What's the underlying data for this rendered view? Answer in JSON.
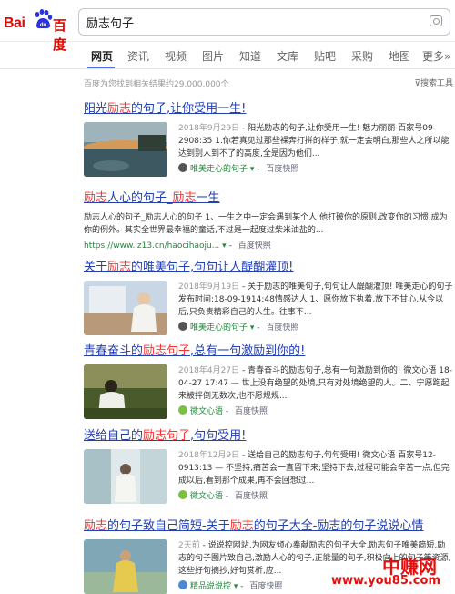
{
  "brand": {
    "logo_text_left": "Bai",
    "logo_text_right": "百度",
    "logo_paw_text": "du"
  },
  "search": {
    "query": "励志句子"
  },
  "tabs": [
    {
      "label": "网页",
      "active": true
    },
    {
      "label": "资讯"
    },
    {
      "label": "视频"
    },
    {
      "label": "图片"
    },
    {
      "label": "知道"
    },
    {
      "label": "文库"
    },
    {
      "label": "贴吧"
    },
    {
      "label": "采购"
    },
    {
      "label": "地图"
    },
    {
      "label": "更多»"
    }
  ],
  "result_count": "百度为您找到相关结果约29,000,000个",
  "search_tools": "搜索工具",
  "results": [
    {
      "title_pre": "阳光",
      "title_em": "励志",
      "title_post": "的句子,让你受用一生!",
      "date": "2018年9月29日",
      "desc": " - 阳光励志的句子,让你受用一生! 魅力丽丽 百家号09-2908:35 1.你若真见过那些裸奔打拼的样子,就一定会明白,那些人之所以能达到别人到不了的高度,全是因为他们...",
      "source": "唯美走心的句子",
      "kuaizhao": "百度快照"
    },
    {
      "title_pre": "",
      "title_em": "励志",
      "title_mid": "人心的句子_",
      "title_em2": "励志",
      "title_post": "一生",
      "desc": "励志人心的句子_励志人心的句子 1、一生之中一定会遇到某个人,他打破你的原则,改变你的习惯,成为你的例外。其实全世界最幸福的童话,不过是一起度过柴米油盐的...",
      "url": "https://www.lz13.cn/haocihaoju...",
      "kuaizhao": "百度快照"
    },
    {
      "title_pre": "关于",
      "title_em": "励志",
      "title_post": "的唯美句子,句句让人醍醐灌顶!",
      "date": "2018年9月19日",
      "desc": " - 关于励志的唯美句子,句句让人醍醐灌顶! 唯美走心的句子 发布时间:18-09-1914:48情感达人 1、愿你放下执着,放下不甘心,从今以后,只负责精彩自己的人生。往事不...",
      "source": "唯美走心的句子",
      "kuaizhao": "百度快照"
    },
    {
      "title_pre": "青春奋斗的",
      "title_em": "励志句子",
      "title_post": ",总有一句激励到你的!",
      "date": "2018年4月27日",
      "desc": " - 青春奋斗的励志句子,总有一句激励到你的! 微文心语 18-04-27 17:47 — 世上没有绝望的处境,只有对处境绝望的人。二、宁愿跑起来被拌倒无数次,也不愿规规...",
      "source": "微文心语",
      "kuaizhao": "百度快照"
    },
    {
      "title_pre": "送给自己的",
      "title_em": "励志句子",
      "title_post": ",句句受用!",
      "date": "2018年12月9日",
      "desc": " - 送给自己的励志句子,句句受用! 微文心语 百家号12-0913:13 — 不坚持,痛苦会一直留下来;坚持下去,过程可能会辛苦一点,但完成以后,看到那个成果,再不会回想过...",
      "source": "微文心语",
      "kuaizhao": "百度快照"
    },
    {
      "title_pre": "",
      "title_em": "励志",
      "title_mid": "的句子致自己简短-关于",
      "title_em2": "励志",
      "title_post": "的句子大全-励志的句子说说心情",
      "date": "2天前",
      "desc": " - 说说控网站,为网友倾心奉献励志的句子大全,励志句子唯美简短,励志的句子图片致自己,激励人心的句子,正能量的句子,积极向上的句子等资源,这些好句摘抄,好句赏析,应...",
      "source": "精品说说控",
      "kuaizhao": "百度快照"
    }
  ],
  "watermark": {
    "line1": "中赚网",
    "line2": "www.you85.com"
  },
  "colors": {
    "link": "#2440b3",
    "highlight": "#f73131",
    "url_green": "#1f8a3a",
    "brand_red": "#e10601",
    "tab_active": "#4e6ef2"
  }
}
